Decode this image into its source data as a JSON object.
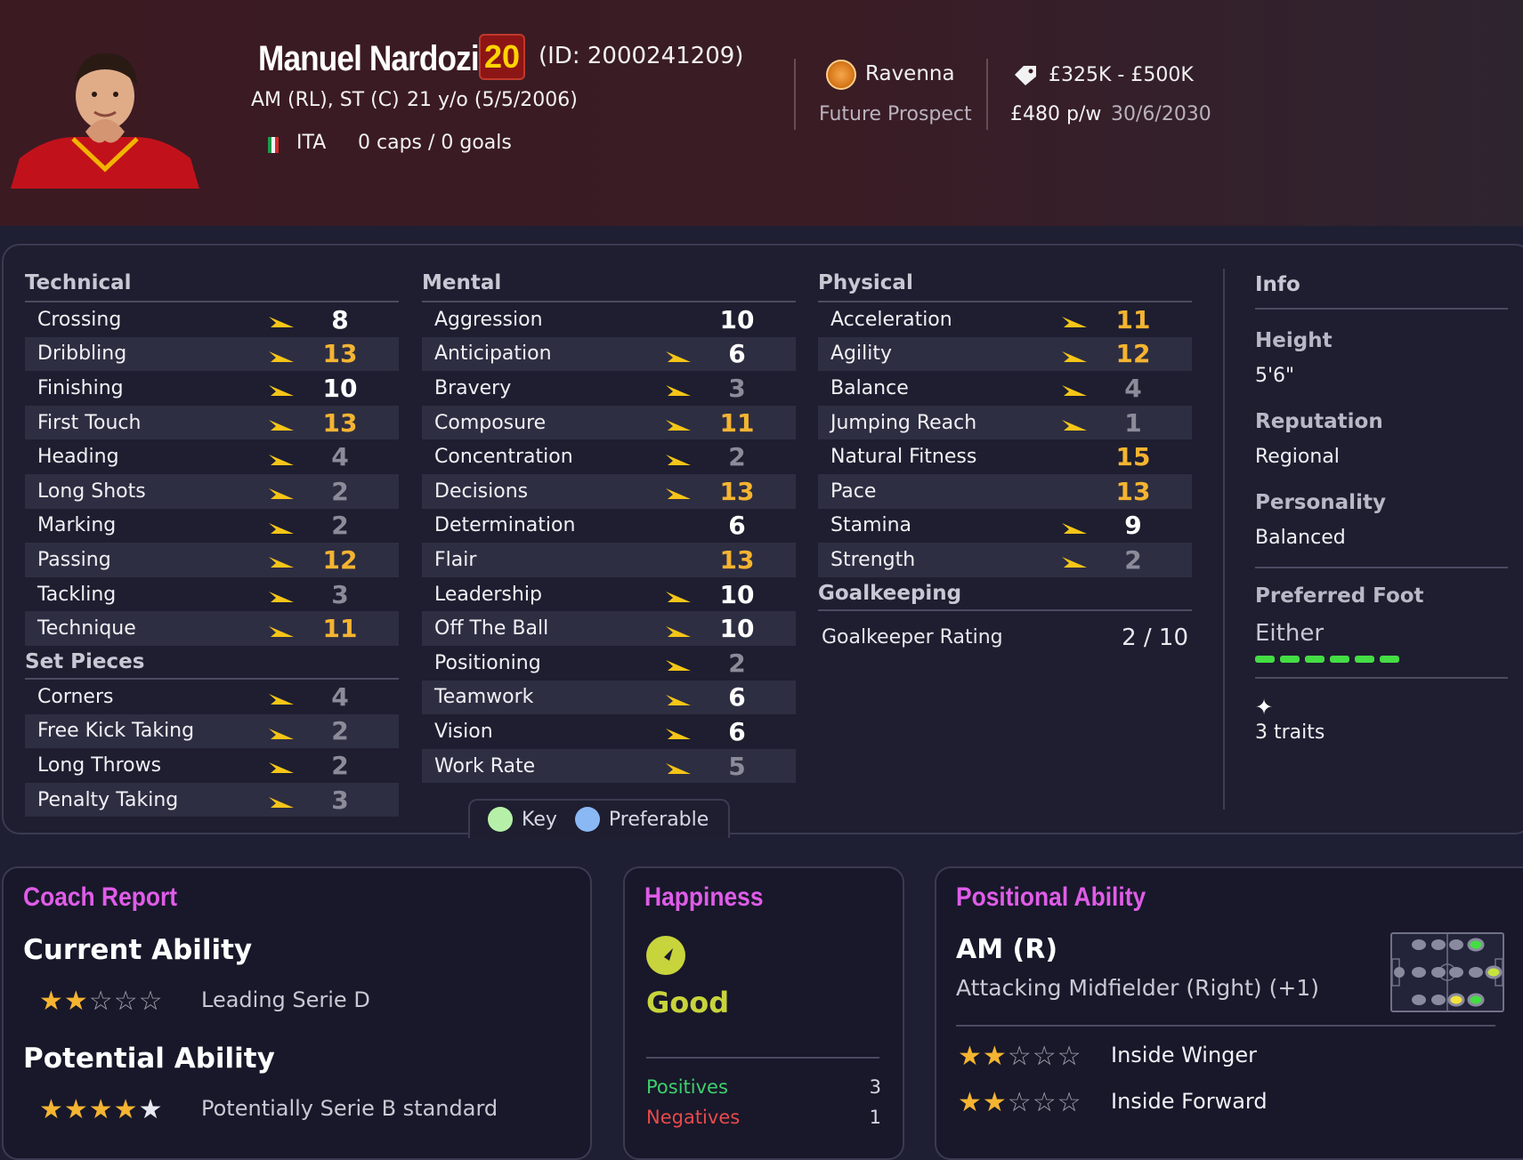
{
  "player": {
    "name": "Manuel Nardozi",
    "age_badge": "20",
    "id_text": "(ID: 2000241209)",
    "positions": "AM (RL), ST (C)",
    "age_text": "21 y/o (5/5/2006)",
    "nation": "ITA",
    "caps": "0 caps / 0 goals",
    "club": "Ravenna",
    "status": "Future Prospect",
    "value": "£325K - £500K",
    "wage": "£480 p/w",
    "contract": "30/6/2030"
  },
  "technical": {
    "title": "Technical",
    "rows": [
      {
        "label": "Crossing",
        "value": "8",
        "level": "mid",
        "arrow": true
      },
      {
        "label": "Dribbling",
        "value": "13",
        "level": "hi",
        "arrow": true
      },
      {
        "label": "Finishing",
        "value": "10",
        "level": "mid",
        "arrow": true
      },
      {
        "label": "First Touch",
        "value": "13",
        "level": "hi",
        "arrow": true
      },
      {
        "label": "Heading",
        "value": "4",
        "level": "lo",
        "arrow": true
      },
      {
        "label": "Long Shots",
        "value": "2",
        "level": "lo",
        "arrow": true
      },
      {
        "label": "Marking",
        "value": "2",
        "level": "lo",
        "arrow": true
      },
      {
        "label": "Passing",
        "value": "12",
        "level": "hi",
        "arrow": true
      },
      {
        "label": "Tackling",
        "value": "3",
        "level": "lo",
        "arrow": true
      },
      {
        "label": "Technique",
        "value": "11",
        "level": "hi",
        "arrow": true
      }
    ]
  },
  "set_pieces": {
    "title": "Set Pieces",
    "rows": [
      {
        "label": "Corners",
        "value": "4",
        "level": "lo",
        "arrow": true
      },
      {
        "label": "Free Kick Taking",
        "value": "2",
        "level": "lo",
        "arrow": true
      },
      {
        "label": "Long Throws",
        "value": "2",
        "level": "lo",
        "arrow": true
      },
      {
        "label": "Penalty Taking",
        "value": "3",
        "level": "lo",
        "arrow": true
      }
    ]
  },
  "mental": {
    "title": "Mental",
    "rows": [
      {
        "label": "Aggression",
        "value": "10",
        "level": "mid",
        "arrow": false
      },
      {
        "label": "Anticipation",
        "value": "6",
        "level": "mid",
        "arrow": true
      },
      {
        "label": "Bravery",
        "value": "3",
        "level": "lo",
        "arrow": true
      },
      {
        "label": "Composure",
        "value": "11",
        "level": "hi",
        "arrow": true
      },
      {
        "label": "Concentration",
        "value": "2",
        "level": "lo",
        "arrow": true
      },
      {
        "label": "Decisions",
        "value": "13",
        "level": "hi",
        "arrow": true
      },
      {
        "label": "Determination",
        "value": "6",
        "level": "mid",
        "arrow": false
      },
      {
        "label": "Flair",
        "value": "13",
        "level": "hi",
        "arrow": false
      },
      {
        "label": "Leadership",
        "value": "10",
        "level": "mid",
        "arrow": true
      },
      {
        "label": "Off The Ball",
        "value": "10",
        "level": "mid",
        "arrow": true
      },
      {
        "label": "Positioning",
        "value": "2",
        "level": "lo",
        "arrow": true
      },
      {
        "label": "Teamwork",
        "value": "6",
        "level": "mid",
        "arrow": true
      },
      {
        "label": "Vision",
        "value": "6",
        "level": "mid",
        "arrow": true
      },
      {
        "label": "Work Rate",
        "value": "5",
        "level": "lo",
        "arrow": true
      }
    ]
  },
  "physical": {
    "title": "Physical",
    "rows": [
      {
        "label": "Acceleration",
        "value": "11",
        "level": "hi",
        "arrow": true
      },
      {
        "label": "Agility",
        "value": "12",
        "level": "hi",
        "arrow": true
      },
      {
        "label": "Balance",
        "value": "4",
        "level": "lo",
        "arrow": true
      },
      {
        "label": "Jumping Reach",
        "value": "1",
        "level": "lo",
        "arrow": true
      },
      {
        "label": "Natural Fitness",
        "value": "15",
        "level": "hi",
        "arrow": false
      },
      {
        "label": "Pace",
        "value": "13",
        "level": "hi",
        "arrow": false
      },
      {
        "label": "Stamina",
        "value": "9",
        "level": "mid",
        "arrow": true
      },
      {
        "label": "Strength",
        "value": "2",
        "level": "lo",
        "arrow": true
      }
    ]
  },
  "goalkeeping": {
    "title": "Goalkeeping",
    "label": "Goalkeeper Rating",
    "value": "2 / 10"
  },
  "info": {
    "title": "Info",
    "height_label": "Height",
    "height_value": "5'6\"",
    "reputation_label": "Reputation",
    "reputation_value": "Regional",
    "personality_label": "Personality",
    "personality_value": "Balanced",
    "foot_label": "Preferred Foot",
    "foot_value": "Either",
    "traits": "3 traits"
  },
  "key": {
    "key_label": "Key",
    "preferable_label": "Preferable",
    "key_color": "#b6f0a8",
    "preferable_color": "#8ab8f4"
  },
  "coach_report": {
    "title": "Coach Report",
    "current_label": "Current Ability",
    "current_stars": 2,
    "current_text": "Leading Serie D",
    "potential_label": "Potential Ability",
    "potential_stars": 4.5,
    "potential_text": "Potentially Serie B standard"
  },
  "happiness": {
    "title": "Happiness",
    "state": "Good",
    "positives_label": "Positives",
    "positives_value": "3",
    "negatives_label": "Negatives",
    "negatives_value": "1"
  },
  "positional": {
    "title": "Positional Ability",
    "position": "AM (R)",
    "full_name": "Attacking Midfielder (Right) (+1)",
    "roles": [
      {
        "label": "Inside Winger",
        "stars": 2
      },
      {
        "label": "Inside Forward",
        "stars": 2
      }
    ]
  },
  "colors": {
    "accent_gold": "#f5b431",
    "title_magenta": "#e05ce8",
    "happy_yellow": "#c8d43c"
  }
}
